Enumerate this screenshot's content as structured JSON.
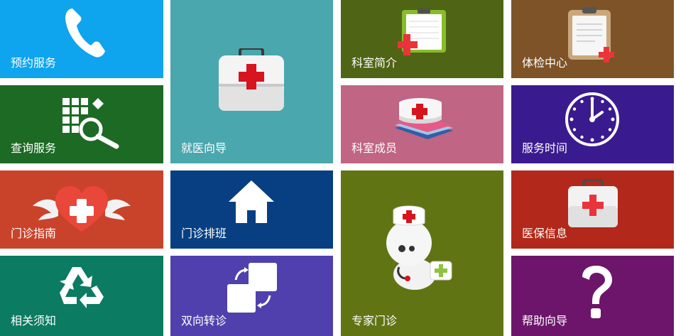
{
  "tiles": [
    {
      "label": "预约服务",
      "color": "#0ea4ee",
      "icon": "phone-icon"
    },
    {
      "label": "查询服务",
      "color": "#1c6a24",
      "icon": "grid-search-icon"
    },
    {
      "label": "门诊指南",
      "color": "#c9432b",
      "icon": "winged-heart-icon"
    },
    {
      "label": "相关须知",
      "color": "#0b7b61",
      "icon": "recycle-icon"
    },
    {
      "label": "就医向导",
      "color": "#4aa7ae",
      "icon": "first-aid-kit-icon"
    },
    {
      "label": "门诊排班",
      "color": "#073f82",
      "icon": "home-icon"
    },
    {
      "label": "双向转诊",
      "color": "#5040ad",
      "icon": "transfer-icon"
    },
    {
      "label": "科室简介",
      "color": "#4f6414",
      "icon": "clipboard-cross-icon"
    },
    {
      "label": "科室成员",
      "color": "#c06584",
      "icon": "nurse-cap-books-icon"
    },
    {
      "label": "专家门诊",
      "color": "#607414",
      "icon": "doctor-mascot-icon"
    },
    {
      "label": "体检中心",
      "color": "#7d5327",
      "icon": "checkup-clipboard-icon"
    },
    {
      "label": "服务时间",
      "color": "#3a1a8f",
      "icon": "clock-icon"
    },
    {
      "label": "医保信息",
      "color": "#b2281a",
      "icon": "medical-case-icon"
    },
    {
      "label": "帮助向导",
      "color": "#6c156a",
      "icon": "question-mark-icon"
    }
  ]
}
